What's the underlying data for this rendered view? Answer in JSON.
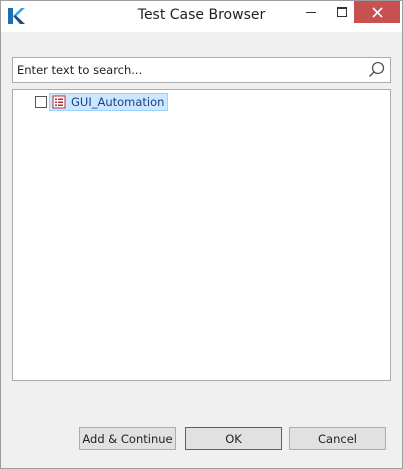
{
  "window": {
    "title": "Test Case Browser"
  },
  "titlebar": {
    "app_icon": "katalon-k-icon",
    "minimize_icon": "minimize-icon",
    "maximize_icon": "maximize-icon",
    "close_icon": "close-icon",
    "close_color": "#c75050"
  },
  "search": {
    "placeholder": "Enter text to search...",
    "value": "",
    "icon": "search-icon"
  },
  "tree": {
    "items": [
      {
        "label": "GUI_Automation",
        "checked": false,
        "selected": true,
        "icon": "test-suite-folder-icon"
      }
    ]
  },
  "buttons": {
    "add_continue": "Add & Continue",
    "ok": "OK",
    "cancel": "Cancel"
  },
  "colors": {
    "selection_bg": "#cce8ff",
    "selection_border": "#99d1ff",
    "focus_border": "#0078d7"
  }
}
